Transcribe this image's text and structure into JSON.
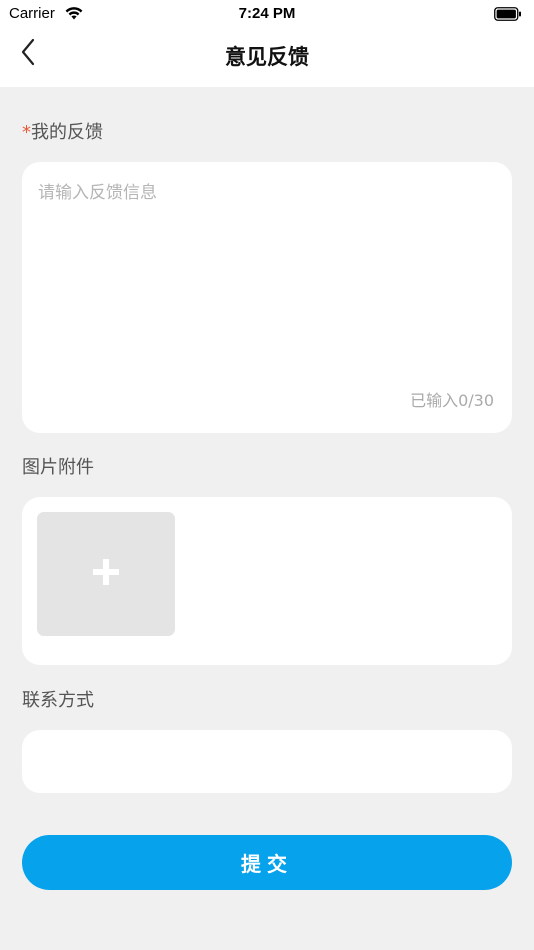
{
  "status_bar": {
    "carrier": "Carrier",
    "time": "7:24 PM",
    "wifi_icon": "wifi-icon",
    "battery_icon": "battery-icon"
  },
  "nav": {
    "title": "意见反馈",
    "back_icon": "chevron-left-icon"
  },
  "feedback": {
    "required_mark": "*",
    "label": "我的反馈",
    "placeholder": "请输入反馈信息",
    "value": "",
    "counter": "已输入0/30"
  },
  "attachments": {
    "label": "图片附件",
    "add_icon": "plus-icon"
  },
  "contact": {
    "label": "联系方式",
    "value": ""
  },
  "submit": {
    "label": "提交"
  },
  "colors": {
    "accent": "#06a3ec",
    "required": "#e55a3b",
    "background": "#f0f0f0"
  }
}
